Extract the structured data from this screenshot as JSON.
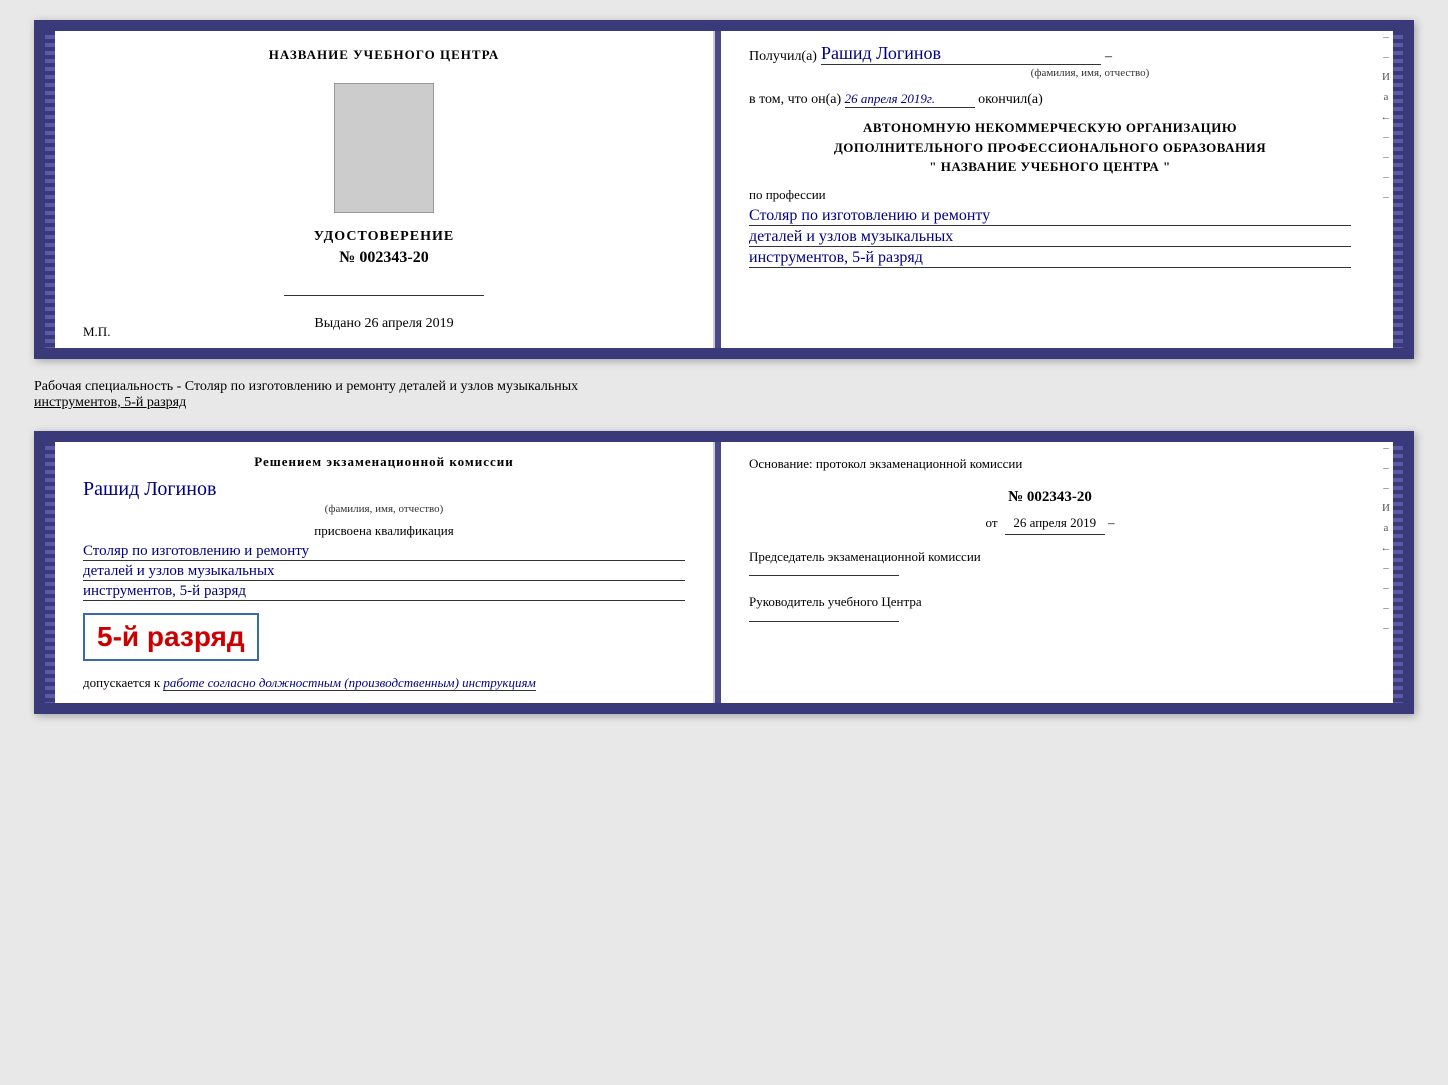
{
  "top_cert": {
    "left": {
      "org_title": "НАЗВАНИЕ УЧЕБНОГО ЦЕНТРА",
      "cert_type": "УДОСТОВЕРЕНИЕ",
      "cert_number_prefix": "№",
      "cert_number": "002343-20",
      "vydano_label": "Выдано",
      "vydano_date": "26 апреля 2019",
      "mp_label": "М.П."
    },
    "right": {
      "poluchil_label": "Получил(а)",
      "recipient_name": "Рашид Логинов",
      "fio_label": "(фамилия, имя, отчество)",
      "vtom_label": "в том, что он(а)",
      "completed_date": "26 апреля 2019г.",
      "okончил_label": "окончил(а)",
      "org_block_line1": "АВТОНОМНУЮ НЕКОММЕРЧЕСКУЮ ОРГАНИЗАЦИЮ",
      "org_block_line2": "ДОПОЛНИТЕЛЬНОГО ПРОФЕССИОНАЛЬНОГО ОБРАЗОВАНИЯ",
      "org_block_line3": "\"    НАЗВАНИЕ УЧЕБНОГО ЦЕНТРА    \"",
      "po_professii_label": "по профессии",
      "profession_line1": "Столяр по изготовлению и ремонту",
      "profession_line2": "деталей и узлов музыкальных",
      "profession_line3": "инструментов, 5-й разряд"
    }
  },
  "separator": {
    "text_before": "Рабочая специальность - Столяр по изготовлению и ремонту деталей и узлов музыкальных",
    "text_underline": "инструментов, 5-й разряд"
  },
  "bottom_cert": {
    "left": {
      "resheniem_label": "Решением экзаменационной комиссии",
      "recipient_name": "Рашид Логинов",
      "fio_label": "(фамилия, имя, отчество)",
      "prisvoena_label": "присвоена квалификация",
      "qual_line1": "Столяр по изготовлению и ремонту",
      "qual_line2": "деталей и узлов музыкальных",
      "qual_line3": "инструментов, 5-й разряд",
      "razryad_big": "5-й разряд",
      "dopuskaetsya_label": "допускается к",
      "dopuskaetsya_italic": "работе согласно должностным (производственным) инструкциям"
    },
    "right": {
      "osnovanie_label": "Основание: протокол экзаменационной комиссии",
      "proto_prefix": "№",
      "proto_number": "002343-20",
      "ot_prefix": "от",
      "ot_date": "26 апреля 2019",
      "predsedatel_label": "Председатель экзаменационной комиссии",
      "rukovoditel_label": "Руководитель учебного Центра"
    }
  },
  "side_labels": {
    "i_label": "И",
    "a_label": "а",
    "arrow_label": "←"
  }
}
